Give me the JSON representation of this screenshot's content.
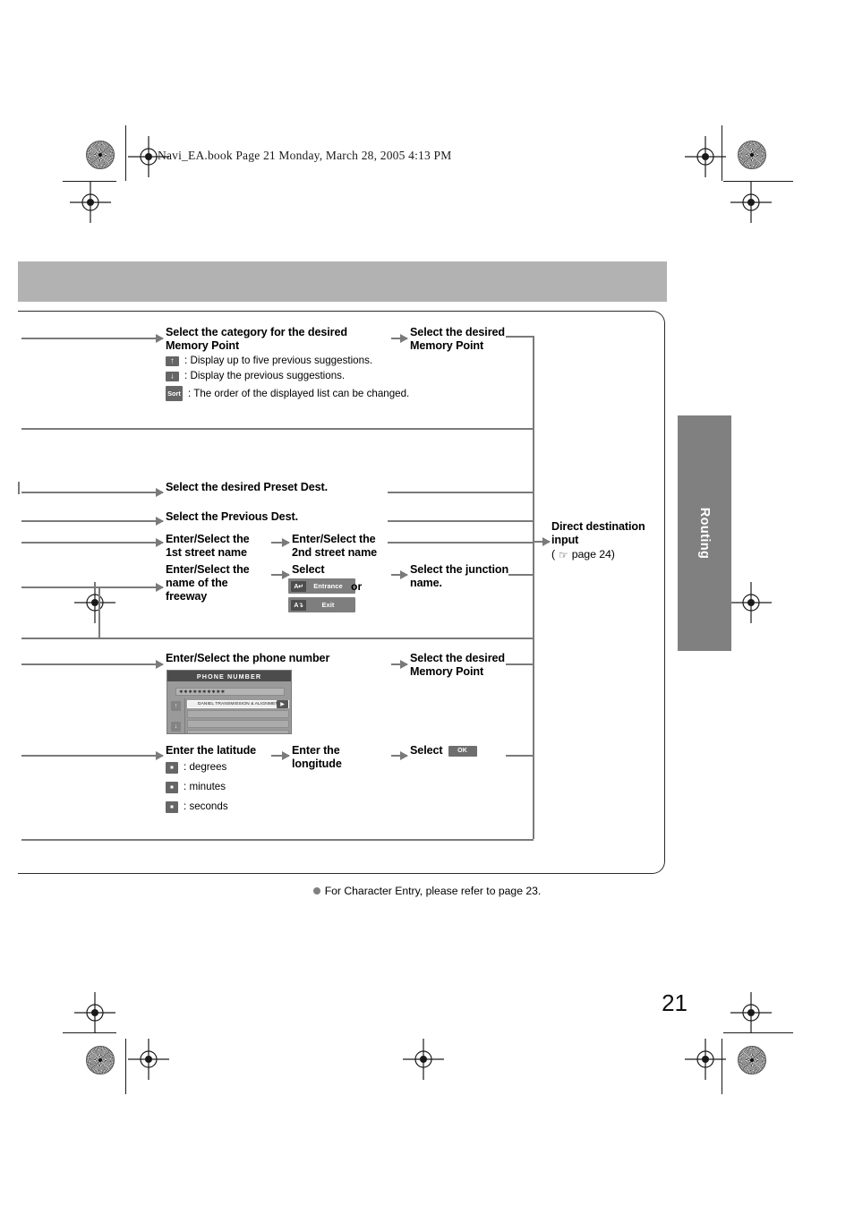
{
  "running_head": "Navi_EA.book  Page 21  Monday, March 28, 2005  4:13 PM",
  "page_number": "21",
  "side_tab": {
    "label": "Routing"
  },
  "flow": {
    "memory_point": {
      "step1": "Select the category for the desired Memory Point",
      "step2": "Select the desired Memory Point",
      "notes": [
        {
          "key": "up-arrow",
          "glyph": "↑",
          "text": ": Display up to five previous suggestions."
        },
        {
          "key": "down-arrow",
          "glyph": "↓",
          "text": ": Display the previous suggestions."
        },
        {
          "key": "Sort",
          "glyph": "Sort",
          "text": ": The order of the displayed list can be changed."
        }
      ]
    },
    "preset_dest": "Select the desired Preset Dest.",
    "previous_dest": "Select the Previous Dest.",
    "street": {
      "step1": "Enter/Select the 1st street name",
      "step2": "Enter/Select the 2nd street name"
    },
    "freeway": {
      "step1": "Enter/Select the name of the freeway",
      "step2": "Select",
      "or_label": "or",
      "buttons": [
        {
          "icon": "freeway-entrance-icon",
          "icon_text": "A↵",
          "label": "Entrance"
        },
        {
          "icon": "freeway-exit-icon",
          "icon_text": "A↴",
          "label": "Exit"
        }
      ],
      "step3": "Select the junction name."
    },
    "phone": {
      "step1": "Enter/Select the phone number",
      "step2": "Select the desired Memory Point",
      "screen": {
        "title": "PHONE NUMBER",
        "input_value": "∗∗∗∗∗∗∗∗∗∗",
        "scroll_up": "↑",
        "scroll_down": "↓",
        "next_page": "▶",
        "rows": [
          "DANIEL TRANSMISSION & ALIGNMEN",
          "",
          "",
          ""
        ]
      }
    },
    "coords": {
      "step1": "Enter the latitude",
      "step2": "Enter the longitude",
      "step3": "Select",
      "ok_label": "OK",
      "notes": [
        {
          "key": "degrees-key",
          "text": ": degrees"
        },
        {
          "key": "minutes-key",
          "text": ": minutes"
        },
        {
          "key": "seconds-key",
          "text": ": seconds"
        }
      ]
    },
    "direct_input": {
      "line1": "Direct destination",
      "line2": "input",
      "ref_open": "(",
      "ref_icon": "☞",
      "ref_text": "page 24)"
    }
  },
  "footer_note": "For Character Entry, please refer to page 23.",
  "colors": {
    "banner": "#b2b2b2",
    "side_tab": "#808080",
    "connector": "#7a7a7a",
    "key": "#666666"
  }
}
